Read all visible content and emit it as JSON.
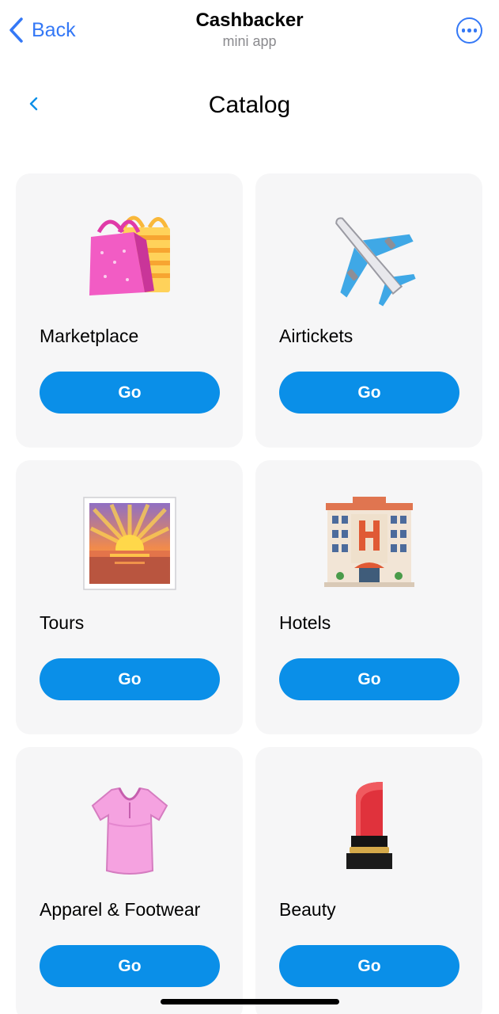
{
  "topbar": {
    "back_label": "Back",
    "title": "Cashbacker",
    "subtitle": "mini app",
    "accent_color": "#3478f6"
  },
  "page": {
    "title": "Catalog"
  },
  "catalog": {
    "button_color": "#0a8fe8",
    "items": [
      {
        "label": "Marketplace",
        "button": "Go",
        "icon": "shopping-bags-icon"
      },
      {
        "label": "Airtickets",
        "button": "Go",
        "icon": "airplane-icon"
      },
      {
        "label": "Tours",
        "button": "Go",
        "icon": "sunrise-icon"
      },
      {
        "label": "Hotels",
        "button": "Go",
        "icon": "hotel-icon"
      },
      {
        "label": "Apparel & Footwear",
        "button": "Go",
        "icon": "blouse-icon"
      },
      {
        "label": "Beauty",
        "button": "Go",
        "icon": "lipstick-icon"
      }
    ]
  }
}
